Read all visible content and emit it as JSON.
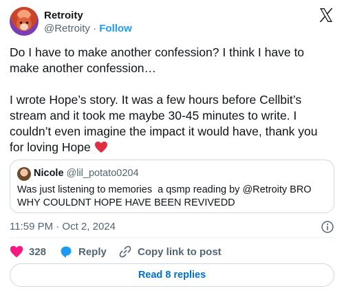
{
  "author": {
    "name": "Retroity",
    "handle": "@Retroity",
    "separator": "·",
    "follow_label": "Follow"
  },
  "tweet": {
    "text": "Do I have to make another confession? I think I have to make another confession…\n\nI wrote Hope’s story. It was a few hours before Cellbit’s stream and it took me maybe 30-45 minutes to write. I couldn’t even imagine the impact it would have, thank you for loving Hope "
  },
  "quote": {
    "name": "Nicole",
    "handle": "@lil_potato0204",
    "text": "Was just listening to memories  a qsmp reading by @Retroity BRO WHY COULDNT HOPE HAVE BEEN REVIVEDD"
  },
  "meta": {
    "timestamp": "11:59 PM · Oct 2, 2024"
  },
  "actions": {
    "like_count": "328",
    "reply_label": "Reply",
    "copy_label": "Copy link to post"
  },
  "footer": {
    "read_replies_label": "Read 8 replies"
  },
  "colors": {
    "accent": "#1d9bf0",
    "like": "#f91880",
    "text": "#0f1419",
    "muted": "#536471"
  },
  "icons": [
    "x-logo-icon",
    "heart-icon",
    "reply-bubble-icon",
    "link-icon",
    "info-icon"
  ]
}
